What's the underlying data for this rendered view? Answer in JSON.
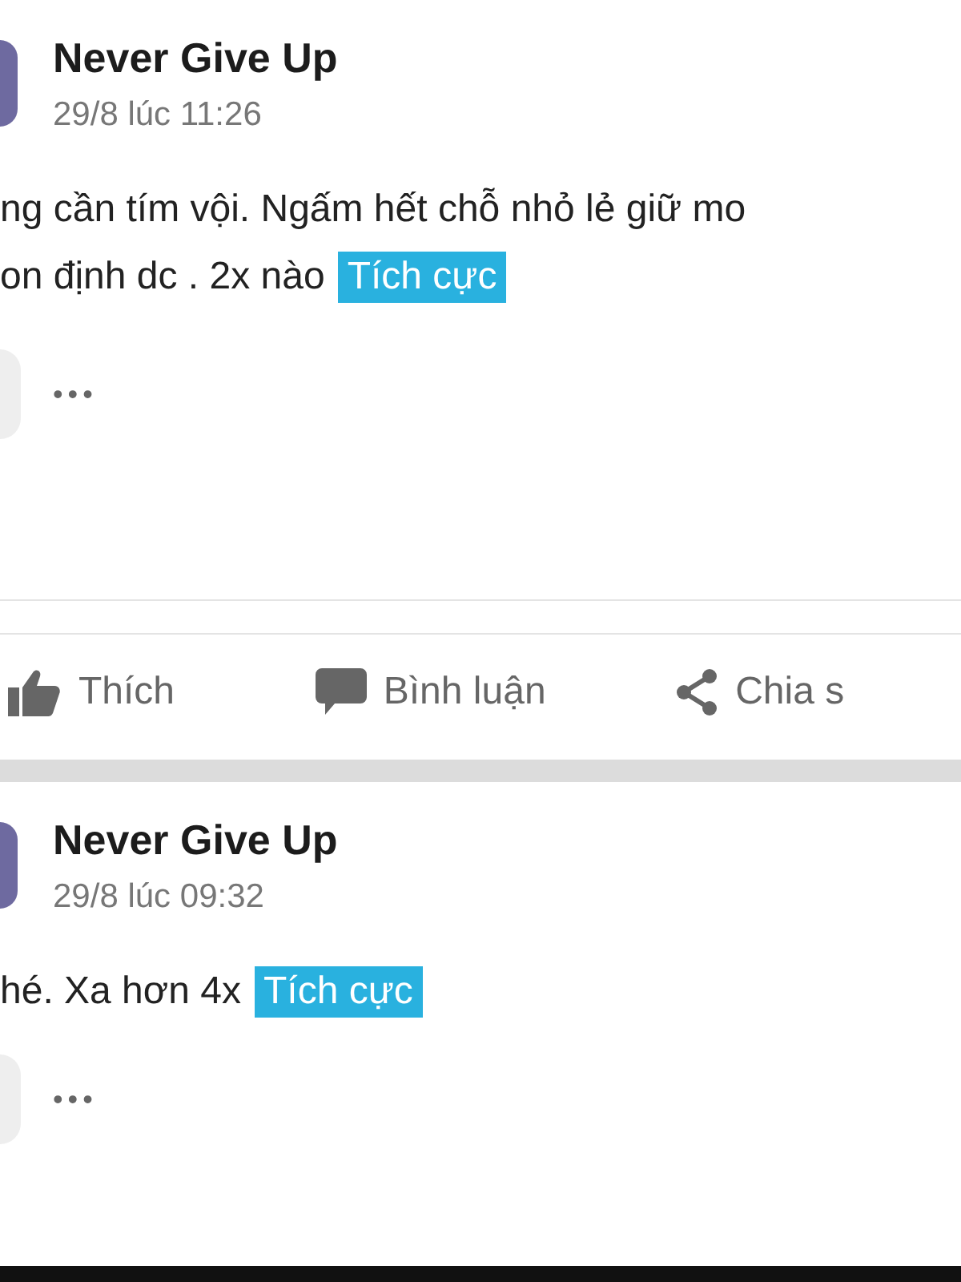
{
  "posts": [
    {
      "author": "Never Give Up",
      "time": "29/8 lúc 11:26",
      "lines": [
        "ng cần tím vội. Ngấm hết chỗ nhỏ lẻ giữ mo",
        "on định dc . 2x nào"
      ],
      "tag": "Tích cực",
      "more": "•••",
      "actions": [
        {
          "kind": "like",
          "label": "Thích"
        },
        {
          "kind": "comment",
          "label": "Bình luận"
        },
        {
          "kind": "share",
          "label": "Chia s"
        }
      ]
    },
    {
      "author": "Never Give Up",
      "time": "29/8 lúc 09:32",
      "lines": [
        "hé. Xa hơn 4x"
      ],
      "tag": "Tích cực",
      "more": "•••"
    }
  ]
}
